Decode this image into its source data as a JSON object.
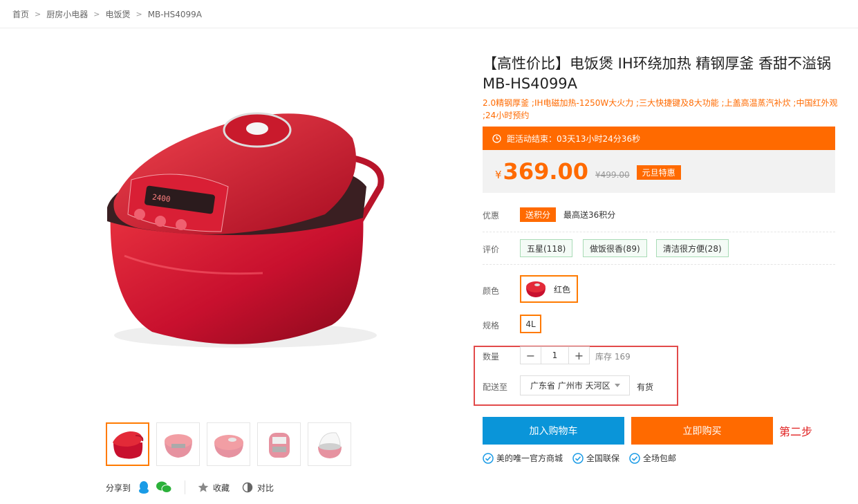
{
  "breadcrumb": {
    "items": [
      "首页",
      "厨房小电器",
      "电饭煲",
      "MB-HS4099A"
    ],
    "separator": ">"
  },
  "product": {
    "title": "【高性价比】电饭煲 IH环绕加热 精钢厚釜 香甜不溢锅 MB-HS4099A",
    "features": "2.0精钢厚釜 ;IH电磁加热-1250W大火力 ;三大快捷键及8大功能 ;上盖高温蒸汽补炊 ;中国红外观 ;24小时预约"
  },
  "promo": {
    "countdown": "距活动结束：03天13小时24分36秒",
    "currency": "¥",
    "price": "369.00",
    "original_price": "¥499.00",
    "tag": "元旦特惠"
  },
  "offers": {
    "label": "优惠",
    "badge": "送积分",
    "text": "最高送36积分"
  },
  "reviews": {
    "label": "评价",
    "tags": [
      "五星(118)",
      "做饭很香(89)",
      "清洁很方便(28)"
    ]
  },
  "color": {
    "label": "颜色",
    "selected": "红色"
  },
  "spec": {
    "label": "规格",
    "selected": "4L"
  },
  "quantity": {
    "label": "数量",
    "minus": "−",
    "value": "1",
    "plus": "+",
    "stock": "库存 169"
  },
  "delivery": {
    "label": "配送至",
    "region": "广东省 广州市 天河区",
    "availability": "有货"
  },
  "actions": {
    "add_to_cart": "加入购物车",
    "buy_now": "立即购买",
    "step_note": "第二步"
  },
  "guarantees": [
    "美的唯一官方商城",
    "全国联保",
    "全场包邮"
  ],
  "share": {
    "label": "分享到",
    "favorite": "收藏",
    "compare": "对比"
  },
  "colors": {
    "accent": "#ff6a00",
    "cart_blue": "#0a95d9",
    "highlight_red": "#e24a4a",
    "product_red": "#c8102e"
  }
}
